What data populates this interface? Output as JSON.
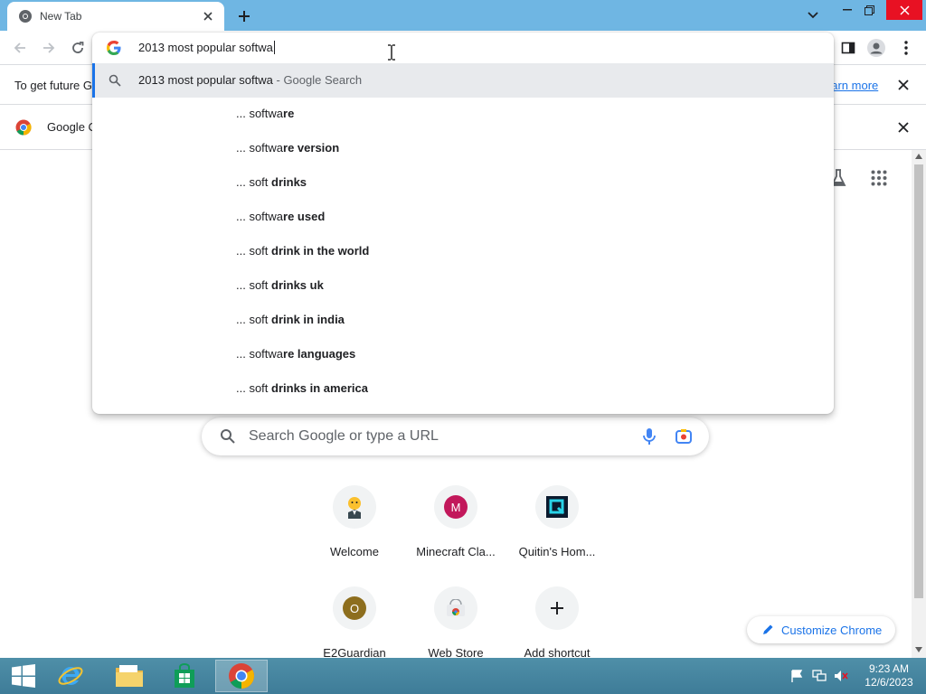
{
  "tab": {
    "title": "New Tab"
  },
  "infobar1": {
    "text": "To get future G",
    "link": "earn more"
  },
  "infobar2": {
    "text": "Google C"
  },
  "omnibox": {
    "input": "2013 most popular softwa",
    "selected": {
      "query": "2013 most popular softwa",
      "suffix": "- Google Search"
    },
    "suggestions": [
      {
        "prefix": "... softwa",
        "bold": "re"
      },
      {
        "prefix": "... softwa",
        "bold": "re version"
      },
      {
        "prefix": "... soft ",
        "bold": "drinks"
      },
      {
        "prefix": "... softwa",
        "bold": "re used"
      },
      {
        "prefix": "... soft ",
        "bold": "drink in the world"
      },
      {
        "prefix": "... soft ",
        "bold": "drinks uk"
      },
      {
        "prefix": "... soft ",
        "bold": "drink in india"
      },
      {
        "prefix": "... softwa",
        "bold": "re languages"
      },
      {
        "prefix": "... soft ",
        "bold": "drinks in america"
      }
    ]
  },
  "search": {
    "placeholder": "Search Google or type a URL"
  },
  "shortcuts": [
    {
      "label": "Welcome",
      "icon": "welcome-icon"
    },
    {
      "label": "Minecraft Cla...",
      "icon": "M",
      "color": "#c2185b"
    },
    {
      "label": "Quitin's Hom...",
      "icon": "quitin-icon"
    },
    {
      "label": "E2Guardian",
      "icon": "O",
      "color": "#8d6e1e"
    },
    {
      "label": "Web Store",
      "icon": "webstore-icon"
    },
    {
      "label": "Add shortcut",
      "icon": "plus-icon"
    }
  ],
  "customize": {
    "label": "Customize Chrome"
  },
  "taskbar": {
    "time": "9:23 AM",
    "date": "12/6/2023"
  },
  "colors": {
    "accent": "#1a73e8",
    "tabstrip": "#6fb6e3",
    "close": "#e81123"
  }
}
